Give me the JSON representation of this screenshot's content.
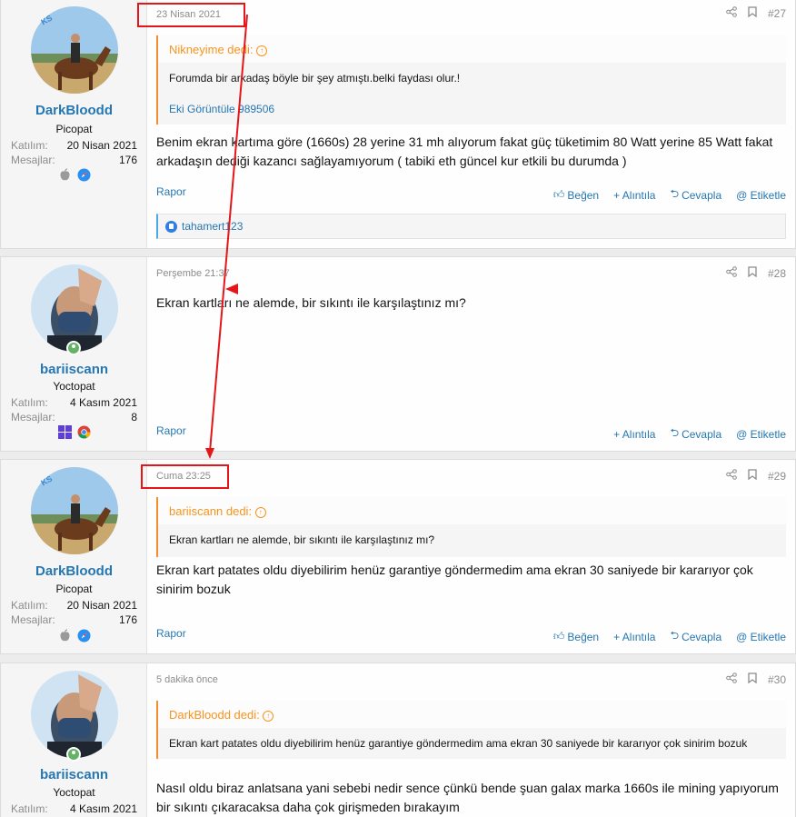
{
  "posts": [
    {
      "username": "DarkBloodd",
      "user_title": "Picopat",
      "joined_label": "Katılım:",
      "joined_value": "20 Nisan 2021",
      "messages_label": "Mesajlar:",
      "messages_value": "176",
      "avatar_badge": "KS",
      "platform_icons": [
        "apple-icon",
        "safari-icon"
      ],
      "date": "23 Nisan 2021",
      "number": "#27",
      "quote": {
        "author": "Nikneyime dedi:",
        "text": "Forumda bir arkadaş böyle bir şey atmıştı.belki faydası olur.!",
        "link": "Eki Görüntüle 989506"
      },
      "message": "Benim ekran kartıma göre (1660s) 28 yerine 31 mh alıyorum fakat güç tüketimim 80 Watt yerine 85 Watt fakat arkadaşın dediği kazancı sağlayamıyorum ( tabiki eth güncel kur etkili bu durumda )",
      "actions": {
        "report": "Rapor",
        "like": "Beğen",
        "quote": "+ Alıntıla",
        "reply": "Cevapla",
        "tag": "@ Etiketle"
      },
      "reactions": "tahamert123"
    },
    {
      "username": "bariiscann",
      "user_title": "Yoctopat",
      "joined_label": "Katılım:",
      "joined_value": "4 Kasım 2021",
      "messages_label": "Mesajlar:",
      "messages_value": "8",
      "platform_icons": [
        "windows-icon",
        "chrome-icon"
      ],
      "date": "Perşembe 21:37",
      "number": "#28",
      "message": "Ekran kartları ne alemde, bir sıkıntı ile karşılaştınız mı?",
      "actions": {
        "report": "Rapor",
        "quote": "+ Alıntıla",
        "reply": "Cevapla",
        "tag": "@ Etiketle"
      }
    },
    {
      "username": "DarkBloodd",
      "user_title": "Picopat",
      "joined_label": "Katılım:",
      "joined_value": "20 Nisan 2021",
      "messages_label": "Mesajlar:",
      "messages_value": "176",
      "avatar_badge": "KS",
      "platform_icons": [
        "apple-icon",
        "safari-icon"
      ],
      "date": "Cuma 23:25",
      "number": "#29",
      "quote": {
        "author": "bariiscann dedi:",
        "text": "Ekran kartları ne alemde, bir sıkıntı ile karşılaştınız mı?"
      },
      "message": "Ekran kart patates oldu diyebilirim henüz garantiye göndermedim ama ekran 30 saniyede bir kararıyor çok sinirim bozuk",
      "actions": {
        "report": "Rapor",
        "like": "Beğen",
        "quote": "+ Alıntıla",
        "reply": "Cevapla",
        "tag": "@ Etiketle"
      }
    },
    {
      "username": "bariiscann",
      "user_title": "Yoctopat",
      "joined_label": "Katılım:",
      "joined_value": "4 Kasım 2021",
      "date": "5 dakika önce",
      "number": "#30",
      "quote": {
        "author": "DarkBloodd dedi:",
        "text": "Ekran kart patates oldu diyebilirim henüz garantiye göndermedim ama ekran 30 saniyede bir kararıyor çok sinirim bozuk"
      },
      "message": "Nasıl oldu biraz anlatsana yani sebebi nedir sence çünkü bende şuan galax marka 1660s ile mining yapıyorum bir sıkıntı çıkaracaksa daha çok girişmeden bırakayım"
    }
  ],
  "colors": {
    "accent_blue": "#2577b1",
    "quote_orange": "#f7941d",
    "annotation_red": "#e5161a",
    "online_green": "#63b265"
  }
}
